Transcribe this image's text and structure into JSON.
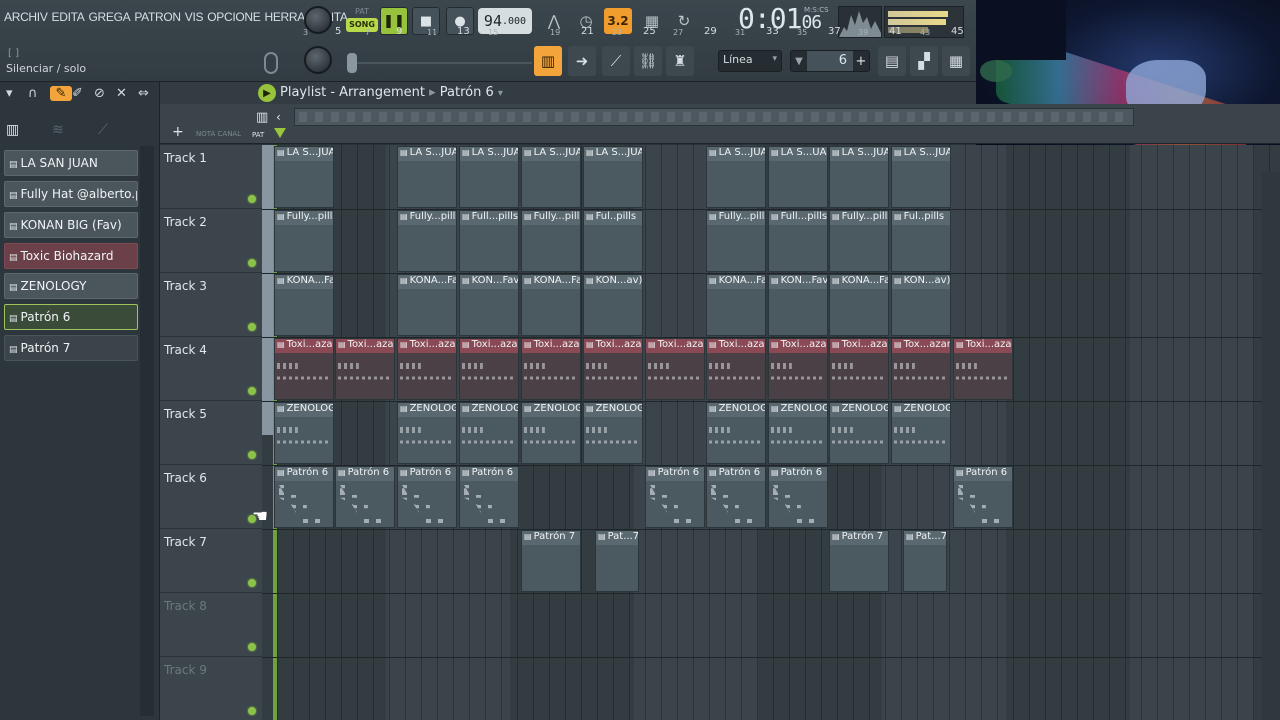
{
  "menu": [
    "ARCHIV",
    "EDITA",
    "GREGA",
    "PATRON",
    "VIS",
    "OPCIONE",
    "HERRAMIENTA"
  ],
  "hint": {
    "bracket": "[ ]",
    "text": "Silenciar / solo"
  },
  "transport": {
    "pat": "PAT",
    "song": "SONG",
    "tempo_int": "94",
    "tempo_dec": ".000",
    "step_label": "3.2",
    "time_main": "0:01",
    "time_sub": "06",
    "time_unit": "M:S:CS"
  },
  "toolbar": {
    "snap": "Línea",
    "stepper_value": "6"
  },
  "browser": {
    "patterns": [
      "LA SAN JUAN",
      "Fully Hat @alberto.pills",
      "KONAN BIG (Fav)",
      "Toxic Biohazard",
      "ZENOLOGY",
      "Patrón 6",
      "Patrón 7"
    ]
  },
  "playlist": {
    "title": "Playlist - Arrangement",
    "current": "Patrón 6",
    "header": {
      "nota": "NOTA",
      "canal": "CANAL",
      "pat": "PAT"
    },
    "ruler_major": [
      "5",
      "9",
      "13",
      "17",
      "21",
      "25",
      "29",
      "33",
      "37",
      "41",
      "45"
    ],
    "ruler_minor": [
      "3",
      "7",
      "11",
      "15",
      "19",
      "23",
      "27",
      "31",
      "35",
      "39",
      "43"
    ],
    "tracks": [
      "Track 1",
      "Track 2",
      "Track 3",
      "Track 4",
      "Track 5",
      "Track 6",
      "Track 7",
      "Track 8",
      "Track 9"
    ],
    "clips": {
      "t1": [
        "LA S...JUAN",
        "LA S...JUAN",
        "LA S...JUAN",
        "LA S...JUAN",
        "LA S...JUAN",
        "LA S...JUAN",
        "LA S...UAN",
        "LA S...JUAN",
        "LA S...JUAN"
      ],
      "t2": [
        "Fully...pills",
        "Fully...pills",
        "Full...pills",
        "Fully...pills",
        "Ful..pills",
        "Fully...pills",
        "Full...pills",
        "Fully...pills",
        "Ful..pills"
      ],
      "t3": [
        "KONA...Fav)",
        "KONA...Fav)",
        "KON...Fav)",
        "KONA...Fav)",
        "KON...av)",
        "KONA...Fav)",
        "KON...Fav)",
        "KONA...Fav)",
        "KON...av)"
      ],
      "t4": [
        "Toxi...azard",
        "Toxi...azard",
        "Toxi...azard",
        "Toxi...azard",
        "Toxi...azard",
        "Toxi...azard",
        "Toxi...azard",
        "Toxi...azard",
        "Toxi...azard",
        "Toxi...azard",
        "Tox...azard",
        "Toxi...azard"
      ],
      "t5": [
        "ZENOLOGY",
        "ZENOLOGY",
        "ZENOLOGY",
        "ZENOLOGY",
        "ZENOLOGY",
        "ZENOLOGY",
        "ZENOLOGY",
        "ZENOLOGY",
        "ZENOLOGY"
      ],
      "t6": [
        "Patrón 6",
        "Patrón 6",
        "Patrón 6",
        "Patrón 6",
        "Patrón 6",
        "Patrón 6",
        "Patrón 6",
        "Patrón 6"
      ],
      "t7": [
        "Patrón 7",
        "Pat...7",
        "Patrón 7",
        "Pat...7"
      ]
    }
  }
}
